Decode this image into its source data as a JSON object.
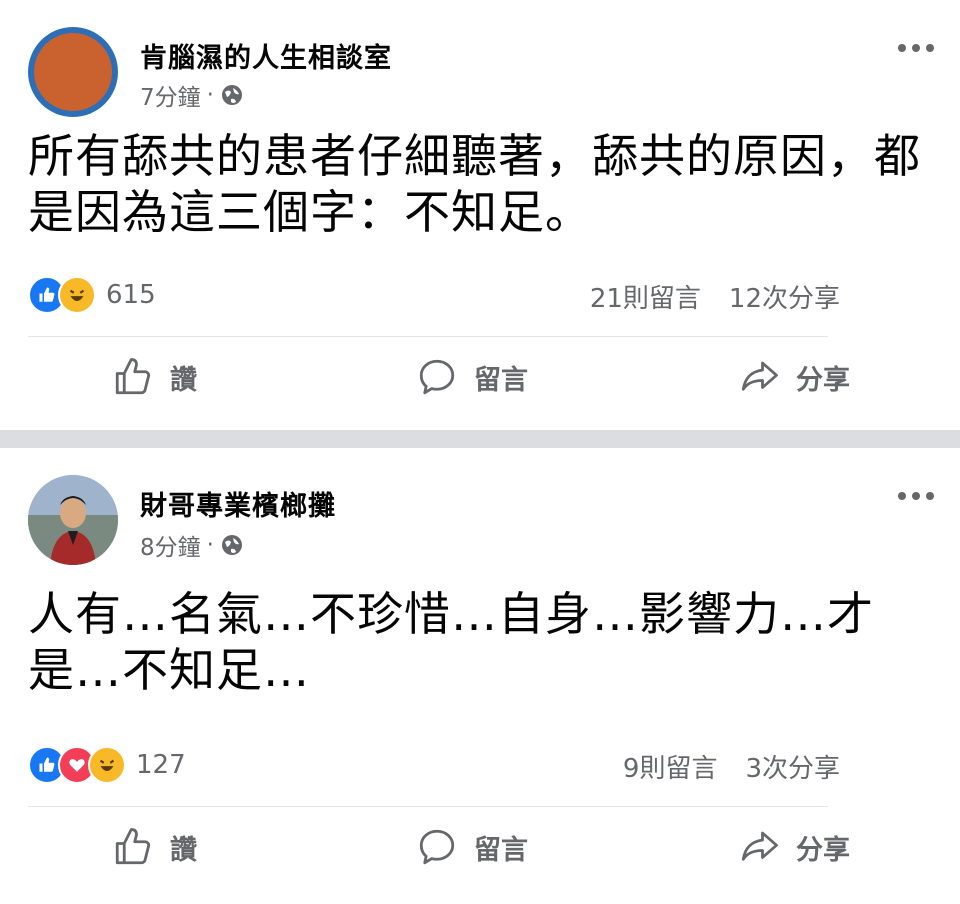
{
  "posts": [
    {
      "author": "肯腦濕的人生相談室",
      "time": "7分鐘",
      "dot": "·",
      "text": "所有舔共的患者仔細聽著，舔共的原因，都是因為這三個字：不知足。",
      "reaction_count": "615",
      "comments": "21則留言",
      "shares": "12次分享"
    },
    {
      "author": "財哥專業檳榔攤",
      "time": "8分鐘",
      "dot": "·",
      "text": "人有…名氣…不珍惜…自身…影響力…才是…不知足…",
      "reaction_count": "127",
      "comments": "9則留言",
      "shares": "3次分享"
    }
  ],
  "actions": {
    "like": "讚",
    "comment": "留言",
    "share": "分享"
  },
  "colors": {
    "like": "#1877f2",
    "love": "#f33e58",
    "haha": "#f7b928",
    "muted": "#65676b",
    "separator": "#dcdde0"
  }
}
